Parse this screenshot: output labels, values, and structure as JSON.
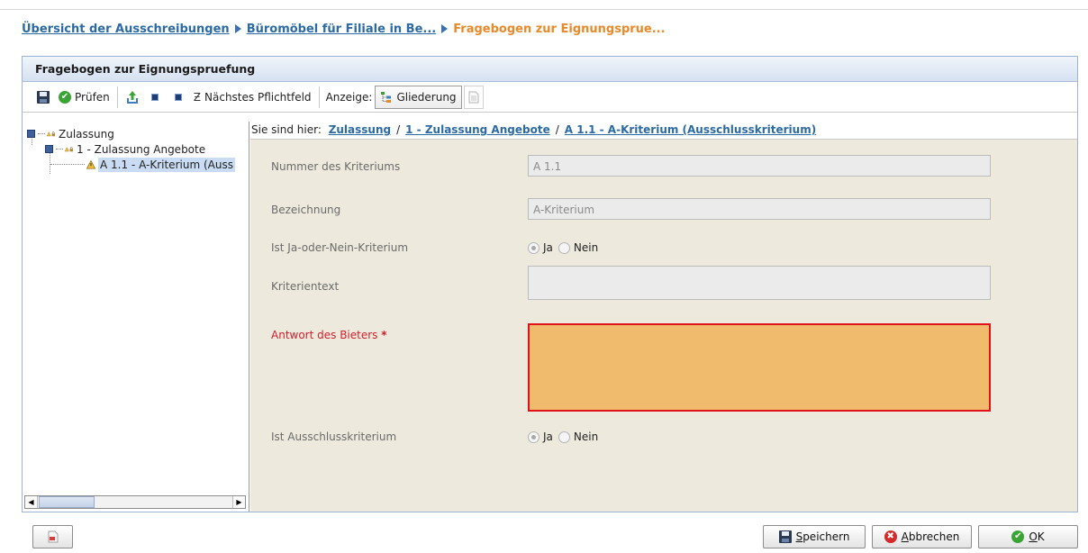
{
  "breadcrumb": {
    "items": [
      {
        "label": "Übersicht der Ausschreibungen"
      },
      {
        "label": "Büromöbel für Filiale in Be..."
      },
      {
        "label": "Fragebogen zur Eignungsprue..."
      }
    ]
  },
  "panel": {
    "title": "Fragebogen zur Eignungspruefung"
  },
  "toolbar": {
    "check_label": "Prüfen",
    "next_required_label": "Nächstes Pflichtfeld",
    "view_label": "Anzeige:",
    "outline_label": "Gliederung"
  },
  "tree": {
    "nodes": [
      {
        "label": "Zulassung"
      },
      {
        "label": "1 - Zulassung Angebote"
      },
      {
        "label": "A 1.1 - A-Kriterium (Auss"
      }
    ]
  },
  "location": {
    "prefix": "Sie sind hier:",
    "items": [
      {
        "label": "Zulassung"
      },
      {
        "label": "1 - Zulassung Angebote"
      },
      {
        "label": "A 1.1 - A-Kriterium (Ausschlusskriterium)"
      }
    ],
    "separator": "/"
  },
  "form": {
    "number_label": "Nummer des Kriteriums",
    "number_value": "A 1.1",
    "name_label": "Bezeichnung",
    "name_value": "A-Kriterium",
    "yesno_label": "Ist Ja-oder-Nein-Kriterium",
    "yes_label": "Ja",
    "no_label": "Nein",
    "criteria_text_label": "Kriterientext",
    "criteria_text_value": "",
    "answer_label": "Antwort des Bieters",
    "answer_required_mark": "*",
    "answer_value": "",
    "exclusion_label": "Ist Ausschlusskriterium",
    "exclusion_yes_label": "Ja",
    "exclusion_no_label": "Nein"
  },
  "buttons": {
    "save_label": "Speichern",
    "save_accel": "S",
    "save_rest": "peichern",
    "cancel_accel": "A",
    "cancel_rest": "bbrechen",
    "ok_accel": "O",
    "ok_rest": "K"
  },
  "colors": {
    "link": "#2b6aa3",
    "current_crumb": "#e8892a",
    "required": "#d0202c",
    "answer_fill": "#f0bb6d",
    "answer_border": "#e2121b",
    "form_background": "#ede9dc"
  }
}
